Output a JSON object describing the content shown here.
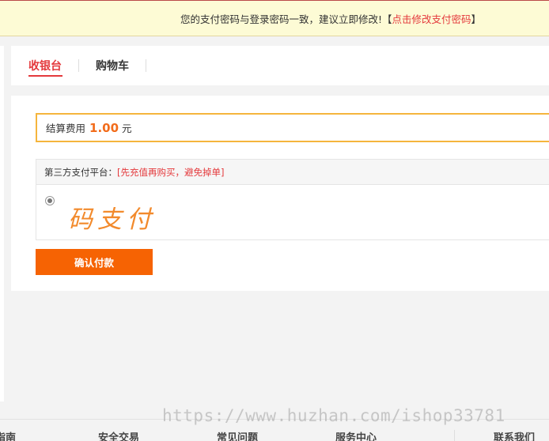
{
  "notice": {
    "text": "您的支付密码与登录密码一致，建议立即修改!",
    "bracket_open": "【",
    "link": "点击修改支付密码",
    "bracket_close": "】"
  },
  "tabs": [
    {
      "label": "收银台"
    },
    {
      "label": "购物车"
    }
  ],
  "amount": {
    "label": "结算费用",
    "value": "1.00",
    "unit": "元"
  },
  "payment": {
    "label": "第三方支付平台：",
    "warning": "[先充值再购买，避免掉单]",
    "method_name": "码支付"
  },
  "confirm_label": "确认付款",
  "footer": {
    "items": [
      "指南",
      "安全交易",
      "常见问题",
      "服务中心",
      "联系我们"
    ]
  },
  "watermark": "https://www.huzhan.com/ishop33781",
  "colors": {
    "accent_red": "#e4393c",
    "button_orange": "#f66303",
    "amount_orange": "#f26c1b",
    "notice_bg": "#fdfbd5"
  }
}
